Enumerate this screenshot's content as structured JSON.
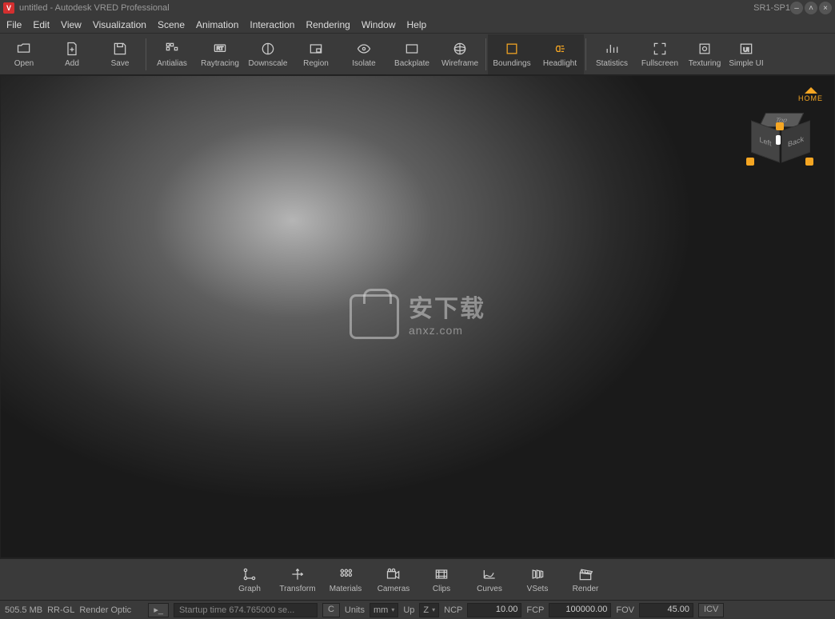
{
  "titlebar": {
    "icon": "V",
    "title": "untitled - Autodesk VRED Professional",
    "sr": "SR1-SP1"
  },
  "menu": [
    "File",
    "Edit",
    "View",
    "Visualization",
    "Scene",
    "Animation",
    "Interaction",
    "Rendering",
    "Window",
    "Help"
  ],
  "toolbar": [
    "Open",
    "Add",
    "Save",
    "Antialias",
    "Raytracing",
    "Downscale",
    "Region",
    "Isolate",
    "Backplate",
    "Wireframe",
    "Boundings",
    "Headlight",
    "Statistics",
    "Fullscreen",
    "Texturing",
    "Simple UI"
  ],
  "toolbar_active": [
    "Boundings",
    "Headlight"
  ],
  "nav": {
    "home": "HOME",
    "top": "Top",
    "left": "Left",
    "back": "Back"
  },
  "watermark": {
    "cn": "安下载",
    "en": "anxz.com"
  },
  "bottombar": [
    "Graph",
    "Transform",
    "Materials",
    "Cameras",
    "Clips",
    "Curves",
    "VSets",
    "Render"
  ],
  "status": {
    "mem": "505.5 MB",
    "mode": "RR-GL",
    "render": "Render Optic",
    "startup": "Startup time 674.765000 se...",
    "c": "C",
    "units_label": "Units",
    "units_value": "mm",
    "up_label": "Up",
    "up_value": "Z",
    "ncp_label": "NCP",
    "ncp_value": "10.00",
    "fcp_label": "FCP",
    "fcp_value": "100000.00",
    "fov_label": "FOV",
    "fov_value": "45.00",
    "icv": "ICV"
  }
}
